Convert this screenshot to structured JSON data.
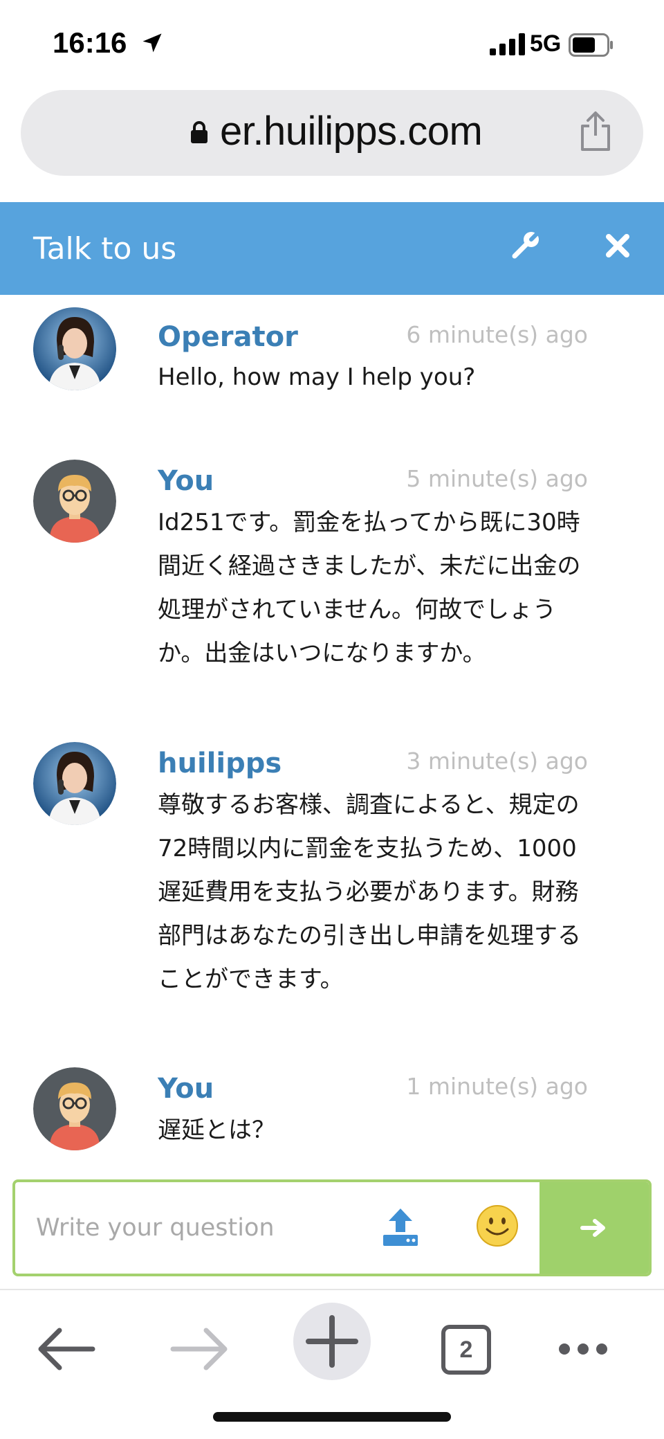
{
  "status_bar": {
    "time": "16:16",
    "network": "5G",
    "icons": [
      "location-arrow-icon",
      "signal-icon",
      "battery-icon"
    ]
  },
  "browser": {
    "url": "er.huilipps.com",
    "tab_count": "2",
    "icons": [
      "lock-icon",
      "share-icon",
      "back-arrow-icon",
      "forward-arrow-icon",
      "plus-icon",
      "more-dots-icon"
    ]
  },
  "chat": {
    "title": "Talk to us",
    "header_icons": [
      "wrench-icon",
      "close-icon"
    ],
    "messages": [
      {
        "author": "Operator",
        "time": "6 minute(s) ago",
        "text": "Hello, how may I help you?",
        "avatar": "operator-avatar"
      },
      {
        "author": "You",
        "time": "5 minute(s) ago",
        "text": "Id251です。罰金を払ってから既に30時間近く経過さきましたが、未だに出金の処理がされていません。何故でしょうか。出金はいつになりますか。",
        "avatar": "user-avatar"
      },
      {
        "author": "huilipps",
        "time": "3 minute(s) ago",
        "text": "尊敬するお客様、調査によると、規定の72時間以内に罰金を支払うため、1000遅延費用を支払う必要があります。財務部門はあなたの引き出し申請を処理することができます。",
        "avatar": "operator-avatar"
      },
      {
        "author": "You",
        "time": "1 minute(s) ago",
        "text": "遅延とは？",
        "avatar": "user-avatar"
      }
    ],
    "input": {
      "placeholder": "Write your question",
      "value": ""
    }
  },
  "colors": {
    "header": "#57a3dd",
    "author": "#3b7fb5",
    "send": "#9fd16b",
    "input_border": "#a4d16e"
  }
}
